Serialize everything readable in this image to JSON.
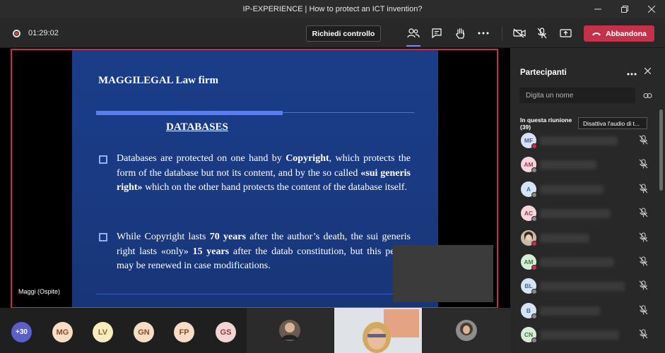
{
  "window": {
    "title": "IP-EXPERIENCE | How to protect an ICT invention?"
  },
  "toolbar": {
    "timer": "01:29:02",
    "request_control_label": "Richiedi controllo",
    "leave_label": "Abbandona"
  },
  "slide": {
    "firm": "MAGGILEGAL Law firm",
    "heading": "DATABASES",
    "para1_runs": [
      {
        "t": "Databases are protected on one hand by ",
        "b": false
      },
      {
        "t": "Copyright",
        "b": true
      },
      {
        "t": ", which protects the form of the database but not its content, and by the so called ",
        "b": false
      },
      {
        "t": "«sui generis right»",
        "b": true
      },
      {
        "t": " which on the other hand protects the content of the database itself.",
        "b": false
      }
    ],
    "para2_runs": [
      {
        "t": "While Copyright lasts ",
        "b": false
      },
      {
        "t": "70 years",
        "b": true
      },
      {
        "t": " after the author’s death, the sui generis right lasts «only» ",
        "b": false
      },
      {
        "t": "15 years",
        "b": true
      },
      {
        "t": " after the datab constitution, but this period may be renewed in case modifications.",
        "b": false
      }
    ]
  },
  "stage": {
    "presenter_label": "Maggi (Ospite)"
  },
  "gallery": {
    "more_count": "+30",
    "avatars": [
      {
        "initials": "MG",
        "bg": "#f7dcc6",
        "fg": "#8a4b26"
      },
      {
        "initials": "LV",
        "bg": "#f8ecc0",
        "fg": "#8a6a14"
      },
      {
        "initials": "GN",
        "bg": "#f7dcc6",
        "fg": "#8a4b26"
      },
      {
        "initials": "FP",
        "bg": "#f7dcc6",
        "fg": "#8a4b26"
      },
      {
        "initials": "GS",
        "bg": "#f3d5d5",
        "fg": "#8a3c3c"
      }
    ]
  },
  "panel": {
    "title": "Partecipanti",
    "search_placeholder": "Digita un nome",
    "section_title": "In questa riunione (39)",
    "mute_all_label": "Disattiva l'audio di t...",
    "participants": [
      {
        "initials": "MF",
        "bg": "#dbe1f5",
        "fg": "#4a5a9a",
        "status": "#c4314b"
      },
      {
        "initials": "AM",
        "bg": "#f6d6dc",
        "fg": "#a03a50",
        "status": "#888888"
      },
      {
        "initials": "A",
        "bg": "#d6e4f5",
        "fg": "#3d6aa0",
        "status": "#888888"
      },
      {
        "initials": "AC",
        "bg": "#f6d6dc",
        "fg": "#a03a50",
        "status": "#888888"
      },
      {
        "initials": "",
        "bg": "#c9b9a8",
        "fg": "#5a4a3a",
        "status": "#c4314b"
      },
      {
        "initials": "AM",
        "bg": "#d8ecd8",
        "fg": "#3d7a3d",
        "status": "#c4314b"
      },
      {
        "initials": "BL",
        "bg": "#d6e4f5",
        "fg": "#3d6aa0",
        "status": "#888888"
      },
      {
        "initials": "B",
        "bg": "#d6e4f5",
        "fg": "#3d6aa0",
        "status": "#888888"
      },
      {
        "initials": "CN",
        "bg": "#d8ecd8",
        "fg": "#3d7a3d",
        "status": "#888888"
      }
    ]
  }
}
